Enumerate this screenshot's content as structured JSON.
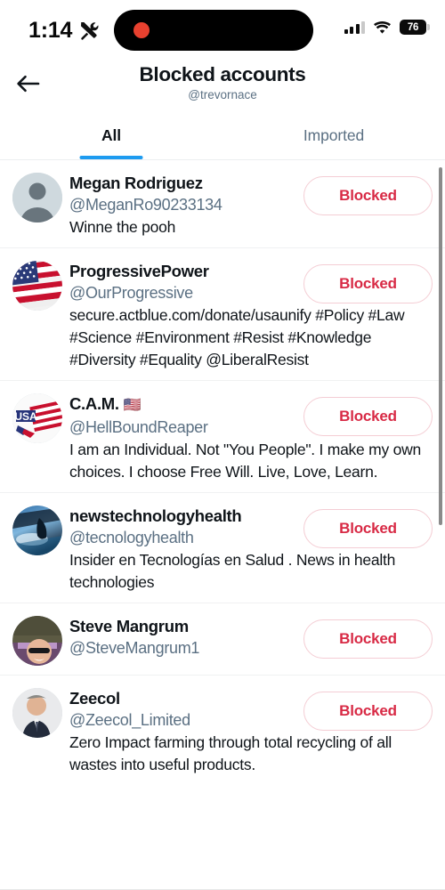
{
  "status_bar": {
    "time": "1:14",
    "tools_icon": "tools-icon",
    "recording_dot": "recording-indicator",
    "signal_icon": "cellular-signal-icon",
    "signal_bars_filled": 3,
    "signal_bars_total": 4,
    "wifi_icon": "wifi-icon",
    "battery_percent": "76",
    "battery_icon": "battery-icon"
  },
  "header": {
    "back_icon": "back-arrow-icon",
    "title": "Blocked accounts",
    "subtitle": "@trevornace"
  },
  "tabs": [
    {
      "label": "All",
      "active": true
    },
    {
      "label": "Imported",
      "active": false
    }
  ],
  "accents": {
    "tab_indicator": "#1d9bf0",
    "blocked_text": "#d82a45",
    "blocked_border": "#f4cdd4",
    "muted_text": "#5b7083",
    "primary_text": "#0f1419"
  },
  "button_labels": {
    "blocked": "Blocked"
  },
  "accounts": [
    {
      "display_name": "Megan Rodriguez",
      "handle": "@MeganRo90233134",
      "bio": "Winne the pooh",
      "avatar": "default-person-avatar",
      "action": "Blocked"
    },
    {
      "display_name": "ProgressivePower",
      "handle": "@OurProgressive",
      "bio": "secure.actblue.com/donate/usaunify #Policy #Law #Science #Environment #Resist #Knowledge #Diversity #Equality @LiberalResist",
      "avatar": "us-flag-avatar",
      "action": "Blocked"
    },
    {
      "display_name": "C.A.M.",
      "display_name_emoji": "🇺🇸",
      "handle": "@HellBoundReaper",
      "bio": "I am an Individual. Not \"You People\". I make my own choices. I choose Free Will. Live, Love, Learn.",
      "avatar": "usa-logo-avatar",
      "action": "Blocked"
    },
    {
      "display_name": "newstechnologyhealth",
      "handle": "@tecnologyhealth",
      "bio": "Insider en Tecnologías en Salud . News in health technologies",
      "avatar": "blue-tech-avatar",
      "action": "Blocked"
    },
    {
      "display_name": "Steve Mangrum",
      "handle": "@SteveMangrum1",
      "bio": "",
      "avatar": "photo-sunglasses-avatar",
      "action": "Blocked"
    },
    {
      "display_name": "Zeecol",
      "handle": "@Zeecol_Limited",
      "bio": "Zero Impact farming through total recycling of all wastes into useful products.",
      "avatar": "photo-suit-avatar",
      "action": "Blocked"
    }
  ]
}
